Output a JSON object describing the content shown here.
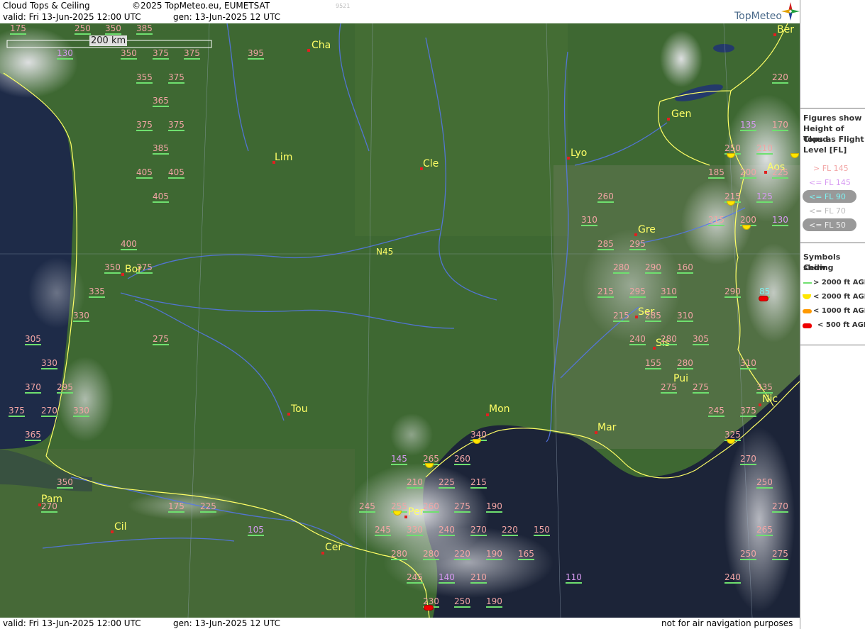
{
  "header": {
    "title": "Cloud Tops & Ceiling",
    "copyright": "©2025 TopMeteo.eu, EUMETSAT",
    "valid": "valid:  Fri  13-Jun-2025  12:00 UTC",
    "gen": "gen: 13-Jun-2025 12 UTC",
    "id_number": "9521",
    "logo": "TopMeteo"
  },
  "footer": {
    "valid": "valid:  Fri  13-Jun-2025  12:00 UTC",
    "gen": "gen: 13-Jun-2025 12 UTC",
    "disclaimer": "not for air navigation purposes"
  },
  "scale": {
    "label": "200 km"
  },
  "graticule": {
    "label": "N45"
  },
  "colors": {
    "gt145": "#f2a5a5",
    "le145": "#d79af2",
    "le90": "#7ff2f2",
    "le70": "#cccccc",
    "le50": "#dddddd",
    "ceil_gt2000": "#6fe06f",
    "ceil_lt2000": "#ffe600",
    "ceil_lt1000": "#ff9900",
    "ceil_lt500": "#ee0000",
    "coast": "#ffff66",
    "river": "#5577ee"
  },
  "legend": {
    "figures_heading": [
      "Figures show",
      "Height of Cloud",
      "Tops as Flight",
      "Level  [FL]"
    ],
    "figure_items": [
      "> FL 145",
      "<= FL 145",
      "<= FL 90",
      "<= FL 70",
      "<= FL 50"
    ],
    "symbols_heading": [
      "Symbols show",
      "Ceiling"
    ],
    "symbol_items": [
      "> 2000 ft AGL",
      "< 2000 ft AGL",
      "< 1000 ft AGL",
      "< 500 ft AGL"
    ]
  },
  "cities": [
    {
      "name": "Cha"
    },
    {
      "name": "Ber"
    },
    {
      "name": "Gen"
    },
    {
      "name": "Lim"
    },
    {
      "name": "Cle"
    },
    {
      "name": "Lyo"
    },
    {
      "name": "Aos"
    },
    {
      "name": "Gre"
    },
    {
      "name": "Bor"
    },
    {
      "name": "Ser"
    },
    {
      "name": "Sis"
    },
    {
      "name": "Pui"
    },
    {
      "name": "Tou"
    },
    {
      "name": "Mon"
    },
    {
      "name": "Mar"
    },
    {
      "name": "Nic"
    },
    {
      "name": "Pam"
    },
    {
      "name": "Per"
    },
    {
      "name": "Cil"
    },
    {
      "name": "Cer"
    }
  ],
  "cloud_tops": [
    {
      "v": "175",
      "c": "pink"
    },
    {
      "v": "250",
      "c": "pink"
    },
    {
      "v": "350",
      "c": "pink"
    },
    {
      "v": "385",
      "c": "pink"
    },
    {
      "v": "350",
      "c": "pink"
    },
    {
      "v": "375",
      "c": "pink"
    },
    {
      "v": "375",
      "c": "pink"
    },
    {
      "v": "395",
      "c": "pink"
    },
    {
      "v": "130",
      "c": "violet"
    },
    {
      "v": "355",
      "c": "pink"
    },
    {
      "v": "375",
      "c": "pink"
    },
    {
      "v": "365",
      "c": "pink"
    },
    {
      "v": "375",
      "c": "pink"
    },
    {
      "v": "375",
      "c": "pink"
    },
    {
      "v": "385",
      "c": "pink"
    },
    {
      "v": "405",
      "c": "pink"
    },
    {
      "v": "405",
      "c": "pink"
    },
    {
      "v": "405",
      "c": "pink"
    },
    {
      "v": "400",
      "c": "pink"
    },
    {
      "v": "350",
      "c": "pink"
    },
    {
      "v": "375",
      "c": "pink"
    },
    {
      "v": "335",
      "c": "pink"
    },
    {
      "v": "330",
      "c": "pink"
    },
    {
      "v": "305",
      "c": "pink"
    },
    {
      "v": "275",
      "c": "pink"
    },
    {
      "v": "330",
      "c": "pink"
    },
    {
      "v": "370",
      "c": "pink"
    },
    {
      "v": "295",
      "c": "pink"
    },
    {
      "v": "375",
      "c": "pink"
    },
    {
      "v": "270",
      "c": "pink"
    },
    {
      "v": "330",
      "c": "pink"
    },
    {
      "v": "365",
      "c": "pink"
    },
    {
      "v": "350",
      "c": "pink"
    },
    {
      "v": "270",
      "c": "pink"
    },
    {
      "v": "175",
      "c": "pink"
    },
    {
      "v": "225",
      "c": "pink"
    },
    {
      "v": "105",
      "c": "violet"
    },
    {
      "v": "220",
      "c": "pink"
    },
    {
      "v": "135",
      "c": "violet"
    },
    {
      "v": "170",
      "c": "pink"
    },
    {
      "v": "250",
      "c": "pink"
    },
    {
      "v": "210",
      "c": "pink"
    },
    {
      "v": "185",
      "c": "pink"
    },
    {
      "v": "200",
      "c": "pink"
    },
    {
      "v": "225",
      "c": "pink"
    },
    {
      "v": "215",
      "c": "pink"
    },
    {
      "v": "125",
      "c": "violet"
    },
    {
      "v": "260",
      "c": "pink"
    },
    {
      "v": "310",
      "c": "pink"
    },
    {
      "v": "215",
      "c": "pink"
    },
    {
      "v": "200",
      "c": "pink"
    },
    {
      "v": "130",
      "c": "violet"
    },
    {
      "v": "285",
      "c": "pink"
    },
    {
      "v": "295",
      "c": "pink"
    },
    {
      "v": "280",
      "c": "pink"
    },
    {
      "v": "290",
      "c": "pink"
    },
    {
      "v": "160",
      "c": "pink"
    },
    {
      "v": "215",
      "c": "pink"
    },
    {
      "v": "295",
      "c": "pink"
    },
    {
      "v": "310",
      "c": "pink"
    },
    {
      "v": "290",
      "c": "pink"
    },
    {
      "v": "85",
      "c": "cyan"
    },
    {
      "v": "215",
      "c": "pink"
    },
    {
      "v": "285",
      "c": "pink"
    },
    {
      "v": "310",
      "c": "pink"
    },
    {
      "v": "240",
      "c": "pink"
    },
    {
      "v": "280",
      "c": "pink"
    },
    {
      "v": "305",
      "c": "pink"
    },
    {
      "v": "155",
      "c": "pink"
    },
    {
      "v": "280",
      "c": "pink"
    },
    {
      "v": "310",
      "c": "pink"
    },
    {
      "v": "275",
      "c": "pink"
    },
    {
      "v": "275",
      "c": "pink"
    },
    {
      "v": "335",
      "c": "pink"
    },
    {
      "v": "245",
      "c": "pink"
    },
    {
      "v": "375",
      "c": "pink"
    },
    {
      "v": "340",
      "c": "pink"
    },
    {
      "v": "325",
      "c": "pink"
    },
    {
      "v": "145",
      "c": "violet"
    },
    {
      "v": "265",
      "c": "pink"
    },
    {
      "v": "260",
      "c": "pink"
    },
    {
      "v": "270",
      "c": "pink"
    },
    {
      "v": "210",
      "c": "pink"
    },
    {
      "v": "225",
      "c": "pink"
    },
    {
      "v": "215",
      "c": "pink"
    },
    {
      "v": "250",
      "c": "pink"
    },
    {
      "v": "245",
      "c": "pink"
    },
    {
      "v": "255",
      "c": "pink"
    },
    {
      "v": "260",
      "c": "pink"
    },
    {
      "v": "275",
      "c": "pink"
    },
    {
      "v": "190",
      "c": "pink"
    },
    {
      "v": "270",
      "c": "pink"
    },
    {
      "v": "245",
      "c": "pink"
    },
    {
      "v": "330",
      "c": "pink"
    },
    {
      "v": "240",
      "c": "pink"
    },
    {
      "v": "270",
      "c": "pink"
    },
    {
      "v": "220",
      "c": "pink"
    },
    {
      "v": "150",
      "c": "pink"
    },
    {
      "v": "265",
      "c": "pink"
    },
    {
      "v": "280",
      "c": "pink"
    },
    {
      "v": "280",
      "c": "pink"
    },
    {
      "v": "220",
      "c": "pink"
    },
    {
      "v": "190",
      "c": "pink"
    },
    {
      "v": "165",
      "c": "pink"
    },
    {
      "v": "250",
      "c": "pink"
    },
    {
      "v": "275",
      "c": "pink"
    },
    {
      "v": "245",
      "c": "pink"
    },
    {
      "v": "140",
      "c": "violet"
    },
    {
      "v": "210",
      "c": "pink"
    },
    {
      "v": "110",
      "c": "violet"
    },
    {
      "v": "240",
      "c": "pink"
    },
    {
      "v": "230",
      "c": "pink"
    },
    {
      "v": "250",
      "c": "pink"
    },
    {
      "v": "190",
      "c": "pink"
    }
  ]
}
